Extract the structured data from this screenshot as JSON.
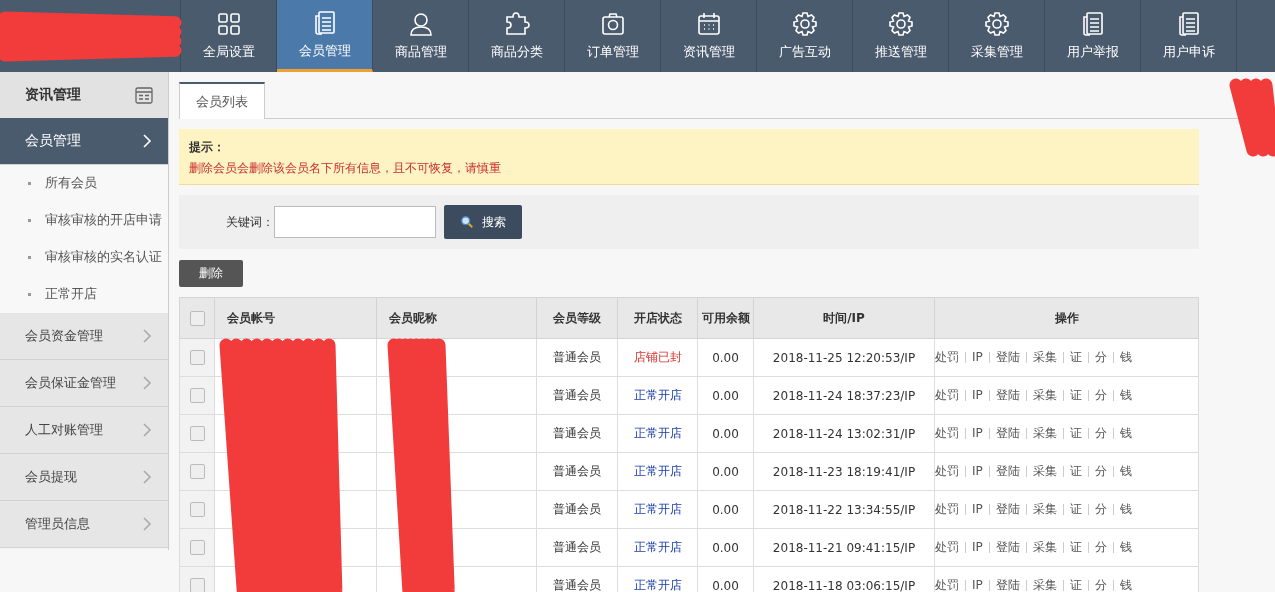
{
  "top_nav": [
    {
      "label": "全局设置",
      "selected": false
    },
    {
      "label": "会员管理",
      "selected": true
    },
    {
      "label": "商品管理",
      "selected": false
    },
    {
      "label": "商品分类",
      "selected": false
    },
    {
      "label": "订单管理",
      "selected": false
    },
    {
      "label": "资讯管理",
      "selected": false
    },
    {
      "label": "广告互动",
      "selected": false
    },
    {
      "label": "推送管理",
      "selected": false
    },
    {
      "label": "采集管理",
      "selected": false
    },
    {
      "label": "用户举报",
      "selected": false
    },
    {
      "label": "用户申诉",
      "selected": false
    }
  ],
  "sidebar": {
    "header": "资讯管理",
    "groups": [
      {
        "label": "会员管理",
        "expanded": true,
        "children": [
          "所有会员",
          "审核审核的开店申请",
          "审核审核的实名认证",
          "正常开店"
        ]
      },
      {
        "label": "会员资金管理",
        "expanded": false
      },
      {
        "label": "会员保证金管理",
        "expanded": false
      },
      {
        "label": "人工对账管理",
        "expanded": false
      },
      {
        "label": "会员提现",
        "expanded": false
      },
      {
        "label": "管理员信息",
        "expanded": false
      }
    ]
  },
  "tabs": [
    {
      "label": "会员列表",
      "selected": true
    }
  ],
  "notice": {
    "title": "提示：",
    "text": "删除会员会删除该会员名下所有信息，且不可恢复，请慎重"
  },
  "search": {
    "label": "关键词：",
    "button": "搜索"
  },
  "delete_button": "删除",
  "table": {
    "select_all_checked": false,
    "columns": [
      "会员帐号",
      "会员昵称",
      "会员等级",
      "开店状态",
      "可用余额",
      "时间/IP",
      "操作"
    ],
    "rows": [
      {
        "checked": false,
        "level": "普通会员",
        "status": {
          "text": "店铺已封",
          "kind": "sealed"
        },
        "balance": "0.00",
        "time": "2018-11-25 12:20:53/IP",
        "actions": [
          "处罚",
          "IP",
          "登陆",
          "采集",
          "证",
          "分",
          "钱"
        ]
      },
      {
        "checked": false,
        "level": "普通会员",
        "status": {
          "text": "正常开店",
          "kind": "open"
        },
        "balance": "0.00",
        "time": "2018-11-24 18:37:23/IP",
        "actions": [
          "处罚",
          "IP",
          "登陆",
          "采集",
          "证",
          "分",
          "钱"
        ]
      },
      {
        "checked": false,
        "level": "普通会员",
        "status": {
          "text": "正常开店",
          "kind": "open"
        },
        "balance": "0.00",
        "time": "2018-11-24 13:02:31/IP",
        "actions": [
          "处罚",
          "IP",
          "登陆",
          "采集",
          "证",
          "分",
          "钱"
        ]
      },
      {
        "checked": false,
        "level": "普通会员",
        "status": {
          "text": "正常开店",
          "kind": "open"
        },
        "balance": "0.00",
        "time": "2018-11-23 18:19:41/IP",
        "actions": [
          "处罚",
          "IP",
          "登陆",
          "采集",
          "证",
          "分",
          "钱"
        ]
      },
      {
        "checked": false,
        "level": "普通会员",
        "status": {
          "text": "正常开店",
          "kind": "open"
        },
        "balance": "0.00",
        "time": "2018-11-22 13:34:55/IP",
        "actions": [
          "处罚",
          "IP",
          "登陆",
          "采集",
          "证",
          "分",
          "钱"
        ]
      },
      {
        "checked": false,
        "level": "普通会员",
        "status": {
          "text": "正常开店",
          "kind": "open"
        },
        "balance": "0.00",
        "time": "2018-11-21 09:41:15/IP",
        "actions": [
          "处罚",
          "IP",
          "登陆",
          "采集",
          "证",
          "分",
          "钱"
        ]
      },
      {
        "checked": false,
        "level": "普通会员",
        "status": {
          "text": "正常开店",
          "kind": "open"
        },
        "balance": "0.00",
        "time": "2018-11-18 03:06:15/IP",
        "actions": [
          "处罚",
          "IP",
          "登陆",
          "采集",
          "证",
          "分",
          "钱"
        ]
      }
    ]
  }
}
